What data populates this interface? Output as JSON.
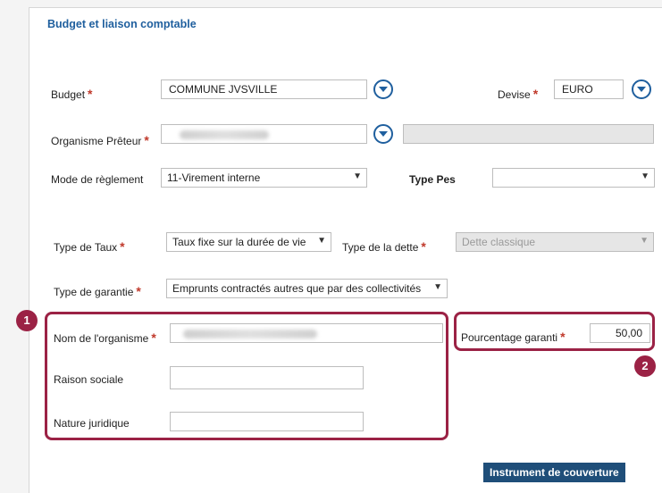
{
  "section": {
    "title": "Budget et liaison comptable"
  },
  "budget": {
    "label": "Budget",
    "value": "COMMUNE JVSVILLE"
  },
  "devise": {
    "label": "Devise",
    "value": "EURO"
  },
  "organisme_preteur": {
    "label": "Organisme Prêteur",
    "value": ""
  },
  "mode_reglement": {
    "label": "Mode de règlement",
    "value": "11-Virement interne"
  },
  "type_pes": {
    "label": "Type Pes",
    "value": ""
  },
  "type_taux": {
    "label": "Type de Taux",
    "value": "Taux fixe sur la durée de vie"
  },
  "type_dette": {
    "label": "Type de la dette",
    "value": "Dette classique"
  },
  "type_garantie": {
    "label": "Type de garantie",
    "value": "Emprunts contractés autres que par des collectivités"
  },
  "nom_organisme": {
    "label": "Nom de l'organisme",
    "value": ""
  },
  "raison_sociale": {
    "label": "Raison  sociale",
    "value": ""
  },
  "nature_juridique": {
    "label": "Nature juridique",
    "value": ""
  },
  "pourcentage": {
    "label": "Pourcentage garanti",
    "value": "50,00"
  },
  "badges": {
    "one": "1",
    "two": "2"
  },
  "action": {
    "label": "Instrument de couverture"
  },
  "colors": {
    "accent": "#1f5f9e",
    "highlight": "#9b2245",
    "required": "#c0392b",
    "button": "#1f4e79"
  }
}
